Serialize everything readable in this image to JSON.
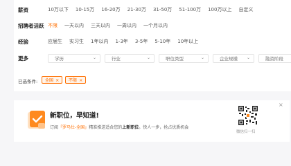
{
  "filters": {
    "salary": {
      "label": "薪资",
      "options": [
        "10万以下",
        "10-15万",
        "16-20万",
        "21-30万",
        "31-50万",
        "51-100万",
        "100万以上",
        "自定义"
      ],
      "active_index": -1
    },
    "recruiter_active": {
      "label": "招聘者活跃",
      "options": [
        "不限",
        "一天以内",
        "三天以内",
        "一周以内",
        "一个月以内"
      ],
      "active_index": 0
    },
    "experience": {
      "label": "经验",
      "options": [
        "应届生",
        "实习生",
        "1年以内",
        "1-3年",
        "3-5年",
        "5-10年",
        "10年以上"
      ],
      "active_index": -1
    },
    "more": {
      "label": "更多",
      "dropdowns": [
        "学历",
        "行业",
        "职位类型",
        "企业规模",
        "融资阶段"
      ]
    }
  },
  "selected": {
    "label": "已选条件:",
    "chips": [
      "全国",
      "不限"
    ],
    "remove_glyph": "×"
  },
  "banner": {
    "title": "新职位，早知道!",
    "desc_prefix": "订阅",
    "desc_highlight": "「罗马仕-全国」",
    "desc_middle": "精准推送适合您的",
    "desc_bold": "上新职位",
    "desc_suffix": "。快人一步，抢占优质机会",
    "qr_caption": "微信扫一扫",
    "close_glyph": "×",
    "icon": "bell-document-icon"
  },
  "colors": {
    "accent": "#ff6f00",
    "chip_bg": "#fff4ea",
    "page_bg": "#f6f6f8"
  }
}
